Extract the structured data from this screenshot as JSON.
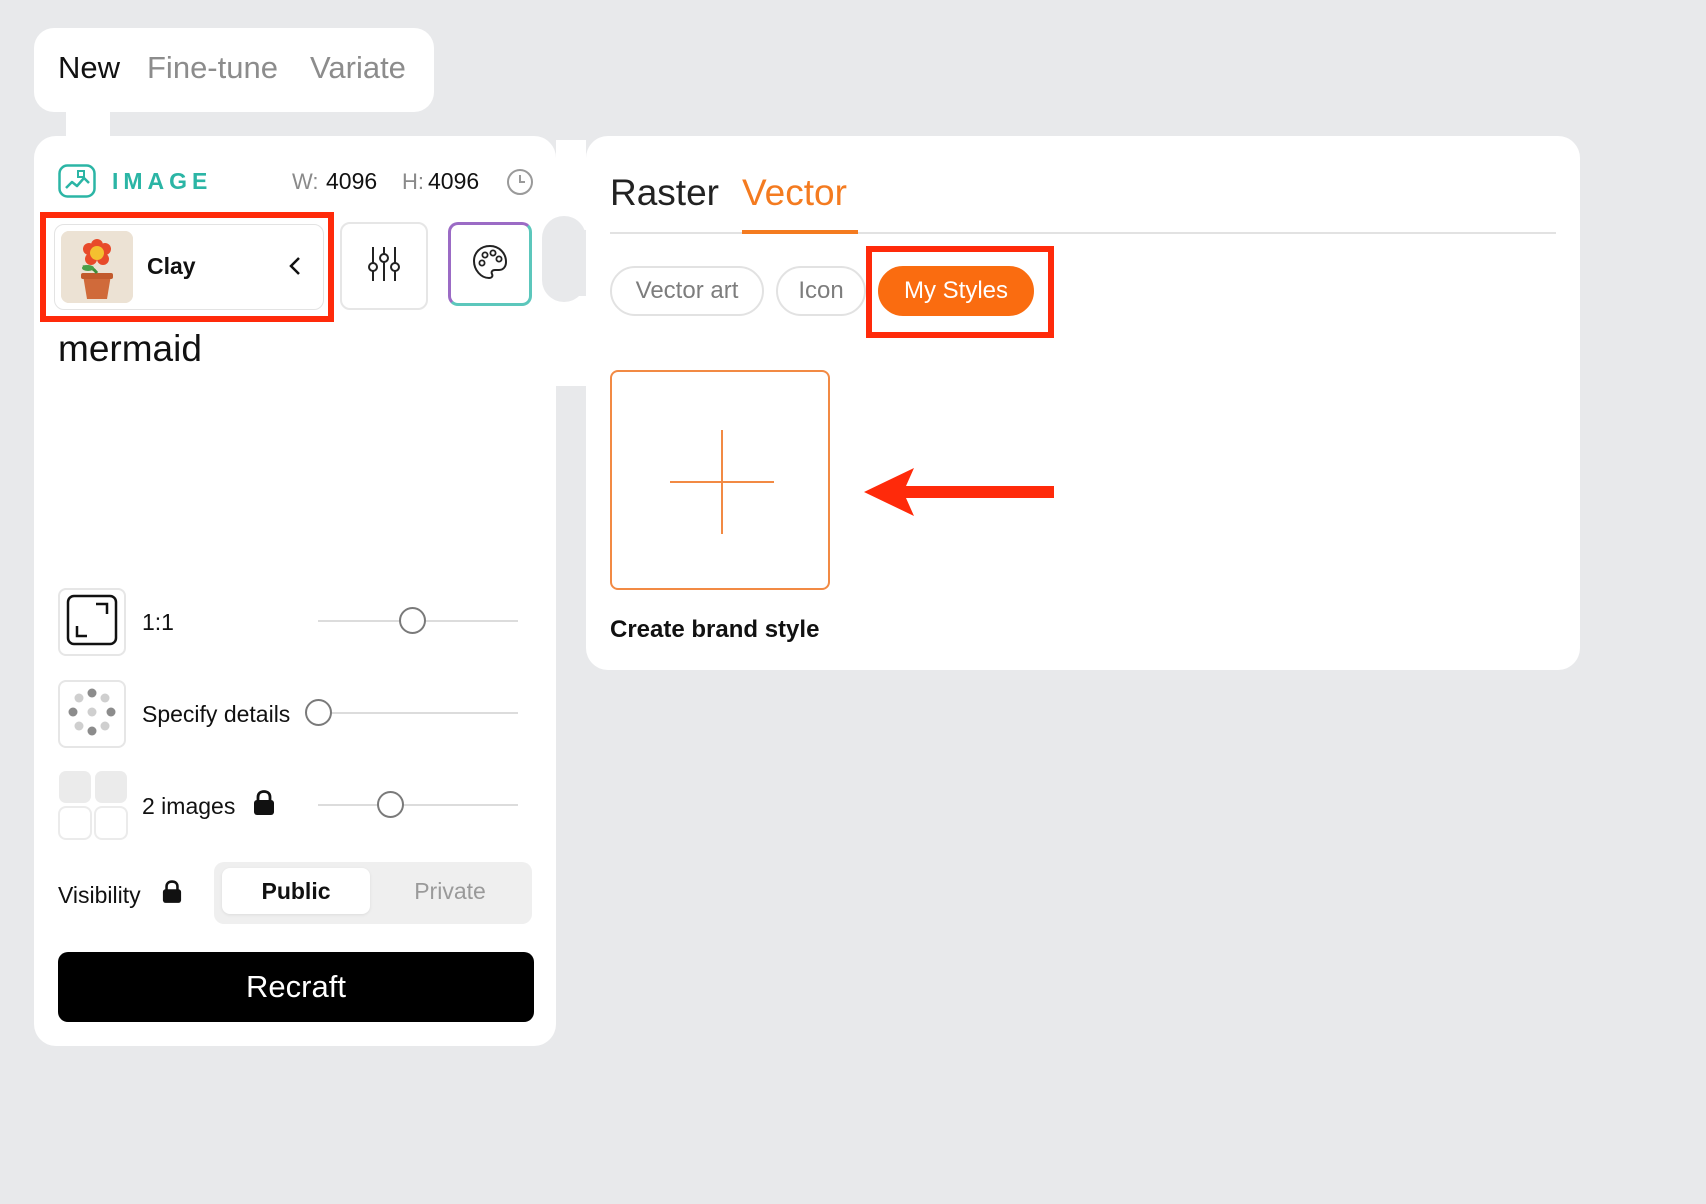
{
  "mode_tabs": [
    "New",
    "Fine-tune",
    "Variate"
  ],
  "left_panel": {
    "section_label": "IMAGE",
    "width_key": "W:",
    "width_value": "4096",
    "height_key": "H:",
    "height_value": "4096",
    "style_name": "Clay",
    "prompt": "mermaid",
    "options": [
      {
        "label": "1:1",
        "slider_position": 0.47
      },
      {
        "label": "Specify details",
        "slider_position": 0.0
      },
      {
        "label": "2 images",
        "slider_position": 0.36
      }
    ],
    "visibility_label": "Visibility",
    "visibility_options": [
      "Public",
      "Private"
    ],
    "visibility_selected": "Public",
    "generate_button": "Recraft"
  },
  "right_panel": {
    "type_tabs": [
      "Raster",
      "Vector"
    ],
    "type_selected": "Vector",
    "style_chips": [
      "Vector art",
      "Icon",
      "My Styles"
    ],
    "chip_selected": "My Styles",
    "create_label": "Create brand style"
  },
  "colors": {
    "accent_orange": "#fa6c10",
    "annotation_red": "#ff2a0a",
    "teal": "#2bb5a5"
  },
  "icons": [
    "image-section-icon",
    "history-icon",
    "chevron-left-icon",
    "sliders-icon",
    "palette-icon",
    "aspect-ratio-icon",
    "details-dots-icon",
    "grid-icon",
    "lock-icon",
    "plus-icon",
    "arrow-left-icon"
  ]
}
